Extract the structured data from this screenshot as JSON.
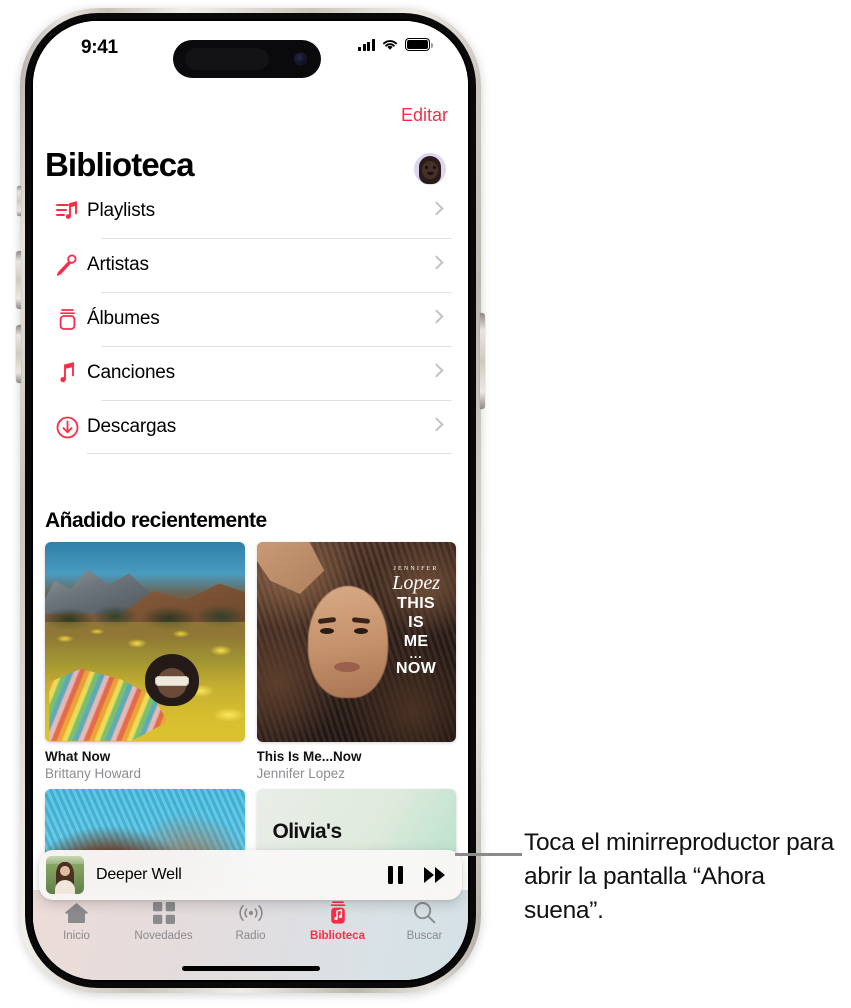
{
  "status_bar": {
    "time": "9:41",
    "cellular_icon": "signal-bars-icon",
    "wifi_icon": "wifi-icon",
    "battery_icon": "battery-icon"
  },
  "nav": {
    "edit_label": "Editar",
    "page_title": "Biblioteca",
    "avatar_label": "avatar"
  },
  "library_rows": [
    {
      "label": "Playlists",
      "icon": "playlist-icon"
    },
    {
      "label": "Artistas",
      "icon": "microphone-icon"
    },
    {
      "label": "Álbumes",
      "icon": "album-icon"
    },
    {
      "label": "Canciones",
      "icon": "music-note-icon"
    },
    {
      "label": "Descargas",
      "icon": "download-icon"
    }
  ],
  "recently_added": {
    "heading": "Añadido recientemente",
    "albums": [
      {
        "title": "What Now",
        "artist": "Brittany Howard"
      },
      {
        "title": "This Is Me...Now",
        "artist": "Jennifer Lopez"
      }
    ],
    "second_row": [
      {
        "title": "",
        "artist": ""
      },
      {
        "title": "Olivia's",
        "artist": ""
      }
    ]
  },
  "jlo_cover_text": {
    "name": "JENNIFER",
    "script": "Lopez",
    "line1": "THIS",
    "line2": "IS",
    "line3": "ME",
    "dots": "...",
    "line4": "NOW"
  },
  "mini_player": {
    "track_title": "Deeper Well",
    "pause_icon": "pause-icon",
    "forward_icon": "fast-forward-icon"
  },
  "tab_bar": {
    "tabs": [
      {
        "label": "Inicio",
        "icon": "home-icon",
        "active": false
      },
      {
        "label": "Novedades",
        "icon": "grid-icon",
        "active": false
      },
      {
        "label": "Radio",
        "icon": "radio-icon",
        "active": false
      },
      {
        "label": "Biblioteca",
        "icon": "library-icon",
        "active": true
      },
      {
        "label": "Buscar",
        "icon": "search-icon",
        "active": false
      }
    ]
  },
  "callout": {
    "text": "Toca el minirreproductor para abrir la pantalla “Ahora suena”."
  },
  "colors": {
    "accent_red": "#fa2d48",
    "secondary_text": "#8c8c91",
    "separator": "#e2e2e4"
  }
}
